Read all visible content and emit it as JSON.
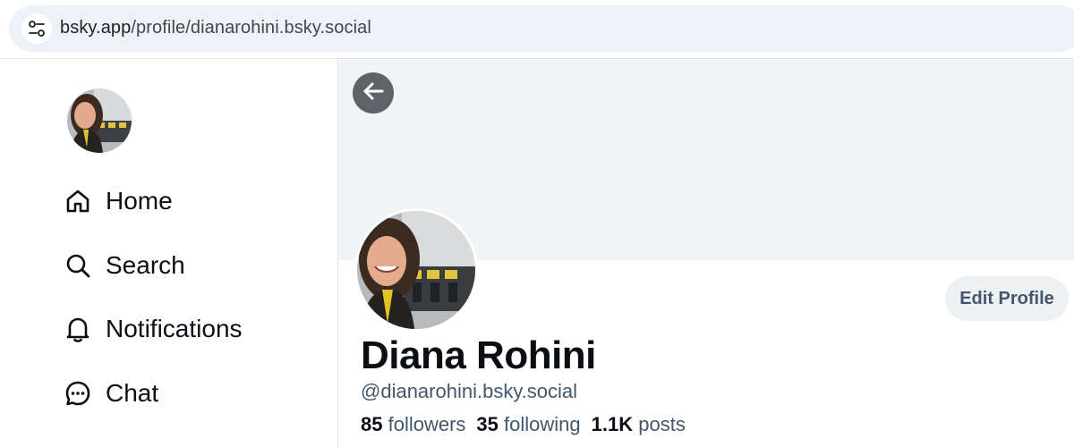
{
  "browser": {
    "url_host": "bsky.app",
    "url_path": "/profile/dianarohini.bsky.social",
    "site_info_icon": "tune-icon"
  },
  "nav": {
    "items": [
      {
        "label": "Home",
        "icon": "home-icon"
      },
      {
        "label": "Search",
        "icon": "search-icon"
      },
      {
        "label": "Notifications",
        "icon": "bell-icon"
      },
      {
        "label": "Chat",
        "icon": "chat-icon"
      }
    ]
  },
  "profile": {
    "display_name": "Diana Rohini",
    "handle": "@dianarohini.bsky.social",
    "edit_label": "Edit Profile",
    "stats": {
      "followers_count": "85",
      "followers_label": "followers",
      "following_count": "35",
      "following_label": "following",
      "posts_count": "1.1K",
      "posts_label": "posts"
    }
  },
  "colors": {
    "banner": "#f1f3f5",
    "muted_text": "#42576c",
    "button_bg": "#eef1f4"
  }
}
